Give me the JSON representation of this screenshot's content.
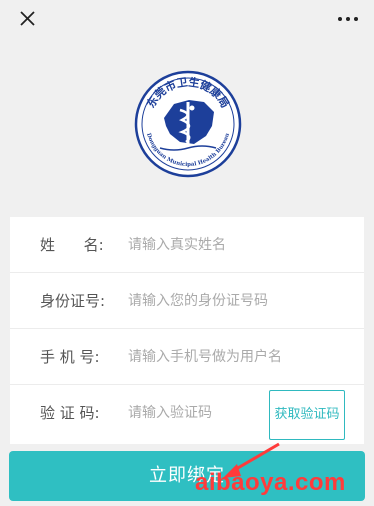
{
  "header": {
    "close_icon": "close-icon",
    "more_icon": "more-dots-icon"
  },
  "logo": {
    "text_cn": "东莞市卫生健康局",
    "text_en": "Dongguan Municipal Health Bureau",
    "colors": {
      "ring": "#1d3f9a",
      "map": "#1d3f9a",
      "emblem": "#ffffff"
    }
  },
  "form": {
    "name": {
      "label": "姓      名:",
      "placeholder": "请输入真实姓名",
      "value": ""
    },
    "id_number": {
      "label": "身份证号:",
      "placeholder": "请输入您的身份证号码",
      "value": ""
    },
    "phone": {
      "label": "手 机 号:",
      "placeholder": "请输入手机号做为用户名",
      "value": ""
    },
    "code": {
      "label": "验 证 码:",
      "placeholder": "请输入验证码",
      "value": ""
    },
    "get_code_label": "获取验证码"
  },
  "submit_label": "立即绑定",
  "watermark": "aibaoya.com",
  "colors": {
    "accent": "#2fbfc2",
    "watermark": "#ff3b3b"
  }
}
